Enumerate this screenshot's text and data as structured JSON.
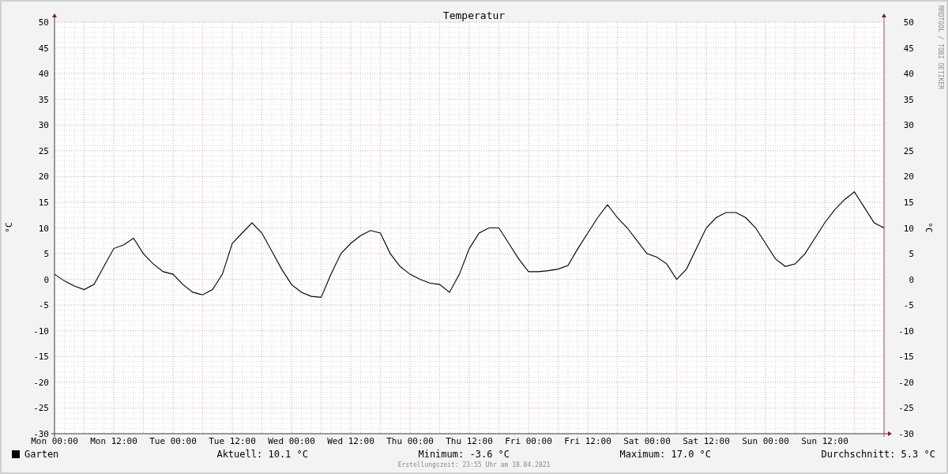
{
  "chart_data": {
    "type": "line",
    "grid": true,
    "y2label": "°C",
    "y2lim": [
      -30,
      50
    ],
    "y2ticks": [
      -30,
      -25,
      -20,
      -15,
      -10,
      -5,
      0,
      5,
      10,
      15,
      20,
      25,
      30,
      35,
      40,
      45,
      50
    ],
    "title": "Temperatur",
    "ylabel": "°C",
    "ylim": [
      -30,
      50
    ],
    "categories": [
      "Mon 00:00",
      null,
      null,
      null,
      null,
      null,
      "Mon 12:00",
      null,
      null,
      null,
      null,
      null,
      "Tue 00:00",
      null,
      null,
      null,
      null,
      null,
      "Tue 12:00",
      null,
      null,
      null,
      null,
      null,
      "Wed 00:00",
      null,
      null,
      null,
      null,
      null,
      "Wed 12:00",
      null,
      null,
      null,
      null,
      null,
      "Thu 00:00",
      null,
      null,
      null,
      null,
      null,
      "Thu 12:00",
      null,
      null,
      null,
      null,
      null,
      "Fri 00:00",
      null,
      null,
      null,
      null,
      null,
      "Fri 12:00",
      null,
      null,
      null,
      null,
      null,
      "Sat 00:00",
      null,
      null,
      null,
      null,
      null,
      "Sat 12:00",
      null,
      null,
      null,
      null,
      null,
      "Sun 00:00",
      null,
      null,
      null,
      null,
      null,
      "Sun 12:00",
      null,
      null,
      null,
      null,
      null,
      null
    ],
    "yticks": [
      -30,
      -25,
      -20,
      -15,
      -10,
      -5,
      0,
      5,
      10,
      15,
      20,
      25,
      30,
      35,
      40,
      45,
      50
    ],
    "series": [
      {
        "name": "Garten",
        "color": "#000000",
        "values": [
          1,
          -0.3,
          -1.3,
          -2,
          -1,
          2.5,
          6,
          6.7,
          8,
          5,
          3,
          1.5,
          1,
          -1,
          -2.5,
          -3,
          -2,
          1,
          7,
          9,
          11,
          9,
          5.5,
          2,
          -1,
          -2.5,
          -3.3,
          -3.5,
          1,
          5,
          7,
          8.5,
          9.5,
          9,
          5,
          2.5,
          1,
          0,
          -0.7,
          -1,
          -2.5,
          1,
          6,
          9,
          10,
          10,
          7,
          4,
          1.5,
          1.5,
          1.7,
          2,
          2.7,
          6,
          9,
          12,
          14.5,
          12,
          10,
          7.5,
          5,
          4.3,
          3,
          0,
          2,
          6,
          10,
          12,
          13,
          13,
          12,
          10,
          7,
          4,
          2.5,
          3,
          5,
          8,
          11,
          13.5,
          15.5,
          17,
          14,
          11,
          10
        ]
      }
    ]
  },
  "legend": {
    "stats": [
      "Aktuell: 10.1 °C",
      "Minimum: -3.6 °C",
      "Maximum: 17.0 °C",
      "Durchschnitt: 5.3 °C"
    ]
  },
  "footer": "Erstellungszeit: 23:55 Uhr am 18.04.2021",
  "credit": "RRDTOOL / TOBI OETIKER"
}
